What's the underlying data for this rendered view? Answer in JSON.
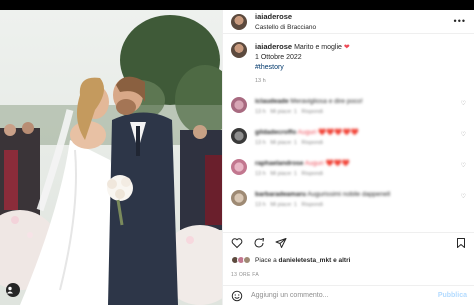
{
  "post": {
    "username": "iaiaderose",
    "location": "Castello di Bracciano",
    "caption_line1": "Marito e moglie",
    "caption_line2": "1 Ottobre 2022",
    "hashtag": "#thestory",
    "caption_time": "13 h"
  },
  "comments": [
    {
      "user": "iclaudeade",
      "text": "Meravigliosa e dire poco!",
      "meta_time": "13 h",
      "meta_likes": "Mi piace: 1",
      "meta_reply": "Rispondi"
    },
    {
      "user": "gildadecroffo",
      "text": "Auguri ❤️❤️❤️❤️❤️",
      "meta_time": "13 h",
      "meta_likes": "Mi piace: 1",
      "meta_reply": "Rispondi"
    },
    {
      "user": "raphaelandrose",
      "text": "Auguri ❤️❤️❤️",
      "meta_time": "13 h",
      "meta_likes": "Mi piace: 1",
      "meta_reply": "Rispondi"
    },
    {
      "user": "barbaradeamaru",
      "text": "Augurissimi nobile dappenell",
      "meta_time": "13 h",
      "meta_likes": "Mi piace: 1",
      "meta_reply": "Rispondi"
    }
  ],
  "likes": {
    "prefix": "Piace a",
    "user": "danieletesta_mkt",
    "suffix": "e altri"
  },
  "posted_ago": "13 ORE FA",
  "add_comment": {
    "placeholder": "Aggiungi un commento...",
    "publish": "Pubblica"
  },
  "icons": {
    "heart": "heart-icon",
    "comment": "comment-icon",
    "share": "share-icon",
    "save": "bookmark-icon",
    "emoji": "emoji-icon",
    "more": "more-icon",
    "user_tag": "user-tag-icon"
  },
  "colors": {
    "link": "#00376b",
    "like_red": "#ed4956",
    "muted": "#8e8e8e"
  }
}
